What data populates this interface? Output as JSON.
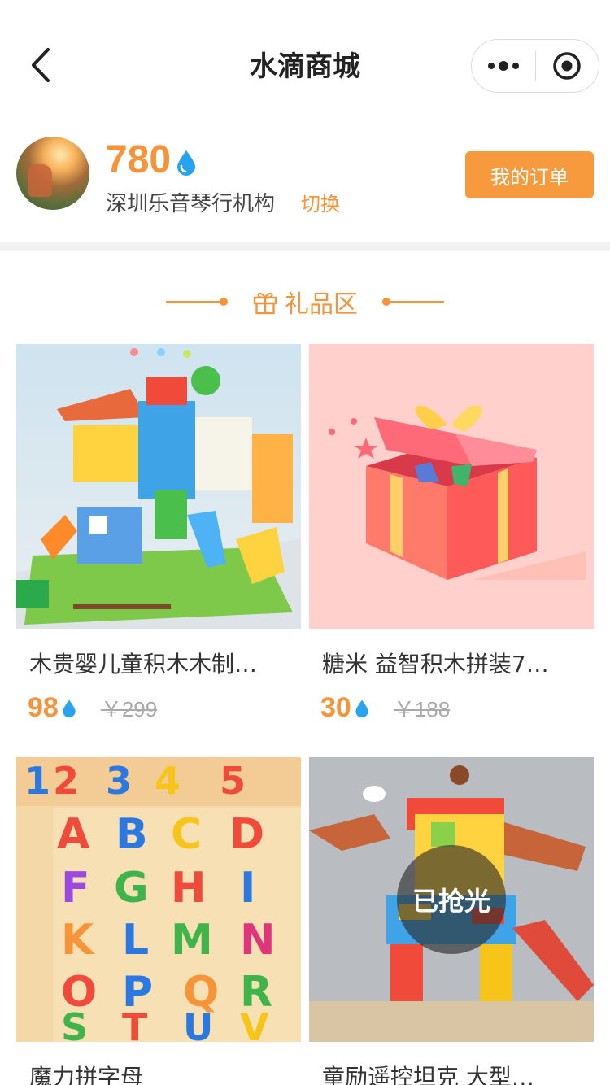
{
  "nav": {
    "title": "水滴商城"
  },
  "user": {
    "points": "780",
    "org_name": "深圳乐音琴行机构",
    "switch_label": "切换",
    "order_button": "我的订单"
  },
  "section": {
    "title": "礼品区"
  },
  "colors": {
    "accent": "#f7943a",
    "drop": "#2aa3ef"
  },
  "products": [
    {
      "name": "木贵婴儿童积木木制…",
      "price": "98",
      "original": "￥299",
      "sold_out": ""
    },
    {
      "name": "糖米 益智积木拼装7…",
      "price": "30",
      "original": "￥188",
      "sold_out": ""
    },
    {
      "name": "魔力拼字母",
      "price": "",
      "original": "",
      "sold_out": ""
    },
    {
      "name": "童励遥控坦克 大型…",
      "price": "",
      "original": "",
      "sold_out": "已抢光"
    }
  ]
}
